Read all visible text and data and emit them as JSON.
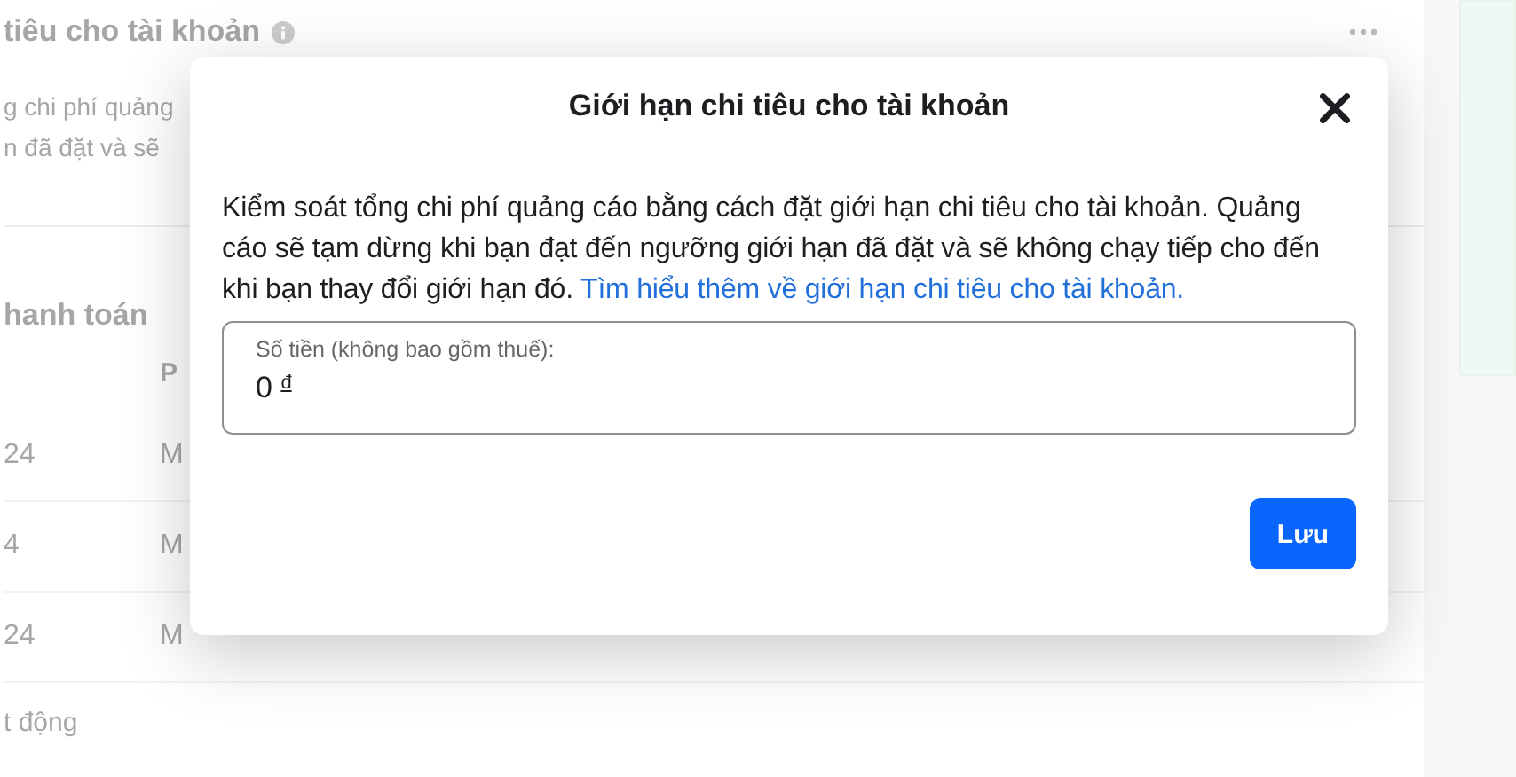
{
  "background": {
    "title": "tiêu cho tài khoản",
    "description_lines": [
      "g chi phí quảng",
      "n đã đặt và sẽ"
    ],
    "section_title": "hanh toán",
    "column_header": "P",
    "rows": [
      {
        "date": "24",
        "method": "M"
      },
      {
        "date": "4",
        "method": "M"
      },
      {
        "date": "24",
        "method": "M"
      }
    ],
    "footer_link": "t động"
  },
  "dialog": {
    "title": "Giới hạn chi tiêu cho tài khoản",
    "body": "Kiểm soát tổng chi phí quảng cáo bằng cách đặt giới hạn chi tiêu cho tài khoản. Quảng cáo sẽ tạm dừng khi bạn đạt đến ngưỡng giới hạn đã đặt và sẽ không chạy tiếp cho đến khi bạn thay đổi giới hạn đó.",
    "link": "Tìm hiểu thêm về giới hạn chi tiêu cho tài khoản.",
    "field": {
      "label": "Số tiền (không bao gồm thuế):",
      "value": "0",
      "currency": "đ"
    },
    "save_button": "Lưu"
  }
}
